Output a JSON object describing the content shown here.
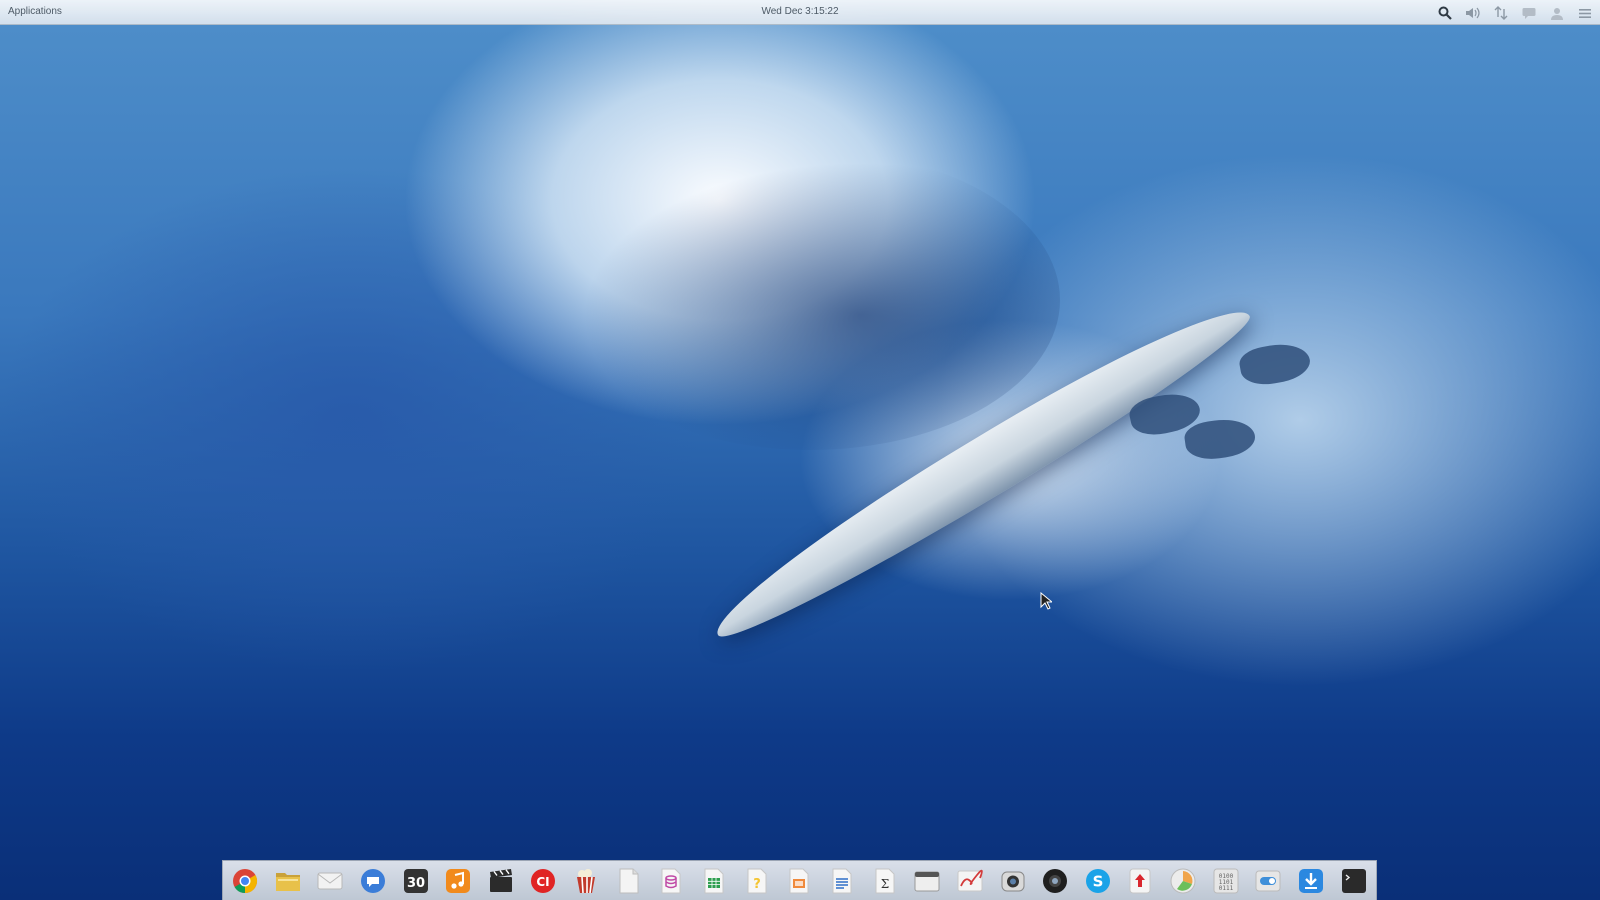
{
  "top_panel": {
    "applications_label": "Applications",
    "clock_text": "Wed Dec  3:15:22",
    "indicators": [
      "search-icon",
      "volume-icon",
      "network-icon",
      "messages-icon",
      "user-icon",
      "menu-icon"
    ]
  },
  "dock": {
    "apps": [
      {
        "icon": "chrome-icon",
        "color": "#db4437"
      },
      {
        "icon": "files-icon",
        "color": "#e8c14a"
      },
      {
        "icon": "mail-icon",
        "color": "#f2f2f2"
      },
      {
        "icon": "chat-icon",
        "color": "#3b7dd8"
      },
      {
        "icon": "calendar-icon",
        "color": "#333333",
        "label": "30"
      },
      {
        "icon": "music-icon",
        "color": "#f18a1c"
      },
      {
        "icon": "video-editor-icon",
        "color": "#2b2b2b"
      },
      {
        "icon": "ci-icon",
        "color": "#e02424",
        "label": "CI"
      },
      {
        "icon": "popcorn-icon",
        "color": "#c23a2b"
      },
      {
        "icon": "document-blank-icon",
        "color": "#f4f4f4"
      },
      {
        "icon": "database-icon",
        "color": "#c04aa6"
      },
      {
        "icon": "spreadsheet-icon",
        "color": "#2e9e4f"
      },
      {
        "icon": "help-icon",
        "color": "#f4d24a"
      },
      {
        "icon": "presentation-icon",
        "color": "#f08a3c"
      },
      {
        "icon": "writer-icon",
        "color": "#2f6fc7"
      },
      {
        "icon": "math-icon",
        "color": "#f2f2f2"
      },
      {
        "icon": "window-manager-icon",
        "color": "#eeeeee"
      },
      {
        "icon": "signature-icon",
        "color": "#d33a3a"
      },
      {
        "icon": "camera-icon",
        "color": "#555555"
      },
      {
        "icon": "webcam-icon",
        "color": "#1f1f1f"
      },
      {
        "icon": "skype-icon",
        "color": "#1aa3e8"
      },
      {
        "icon": "upload-icon",
        "color": "#d9262d"
      },
      {
        "icon": "system-monitor-icon",
        "color": "#f0a44a"
      },
      {
        "icon": "binary-icon",
        "color": "#e6e6e6"
      },
      {
        "icon": "toggle-icon",
        "color": "#3f8fd9"
      },
      {
        "icon": "download-icon",
        "color": "#2b88e0"
      },
      {
        "icon": "terminal-icon",
        "color": "#2a2a2a"
      }
    ]
  }
}
